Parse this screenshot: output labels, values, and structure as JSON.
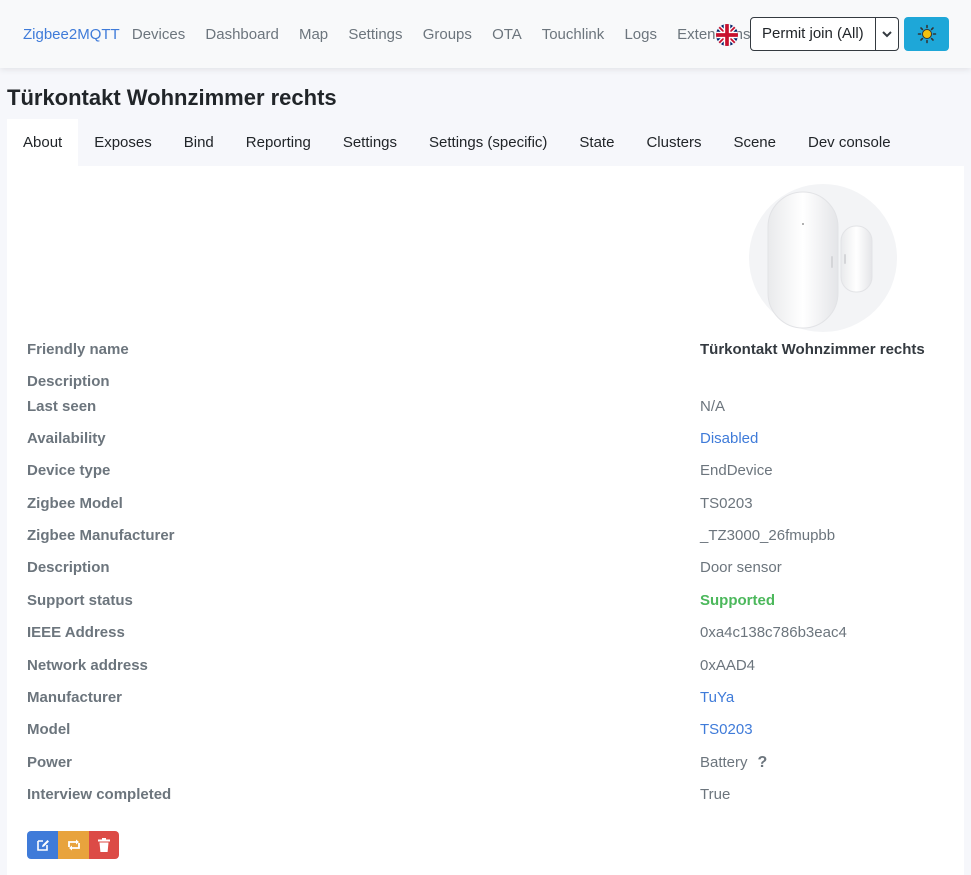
{
  "navbar": {
    "brand": "Zigbee2MQTT",
    "links": [
      "Devices",
      "Dashboard",
      "Map",
      "Settings",
      "Groups",
      "OTA",
      "Touchlink",
      "Logs",
      "Extensions"
    ],
    "language_icon": "uk-flag-icon",
    "permit_join_label": "Permit join (All)",
    "theme_icon": "sun-icon"
  },
  "page": {
    "title": "Türkontakt Wohnzimmer rechts"
  },
  "tabs": [
    "About",
    "Exposes",
    "Bind",
    "Reporting",
    "Settings",
    "Settings (specific)",
    "State",
    "Clusters",
    "Scene",
    "Dev console"
  ],
  "device": {
    "rows": [
      {
        "label": "Friendly name",
        "value": "Türkontakt Wohnzimmer rechts"
      },
      {
        "label": "Description",
        "value": ""
      },
      {
        "label": "Last seen",
        "value": "N/A"
      },
      {
        "label": "Availability",
        "value": "Disabled"
      },
      {
        "label": "Device type",
        "value": "EndDevice"
      },
      {
        "label": "Zigbee Model",
        "value": "TS0203"
      },
      {
        "label": "Zigbee Manufacturer",
        "value": "_TZ3000_26fmupbb"
      },
      {
        "label": "Description",
        "value": "Door sensor"
      },
      {
        "label": "Support status",
        "value": "Supported"
      },
      {
        "label": "IEEE Address",
        "value": "0xa4c138c786b3eac4"
      },
      {
        "label": "Network address",
        "value": "0xAAD4"
      },
      {
        "label": "Manufacturer",
        "value": "TuYa"
      },
      {
        "label": "Model",
        "value": "TS0203"
      },
      {
        "label": "Power",
        "value": "Battery"
      },
      {
        "label": "Interview completed",
        "value": "True"
      }
    ],
    "power_help": "?"
  },
  "actions": {
    "icons": [
      "edit-icon",
      "reconfigure-icon",
      "trash-icon"
    ]
  },
  "colors": {
    "link": "#3f7bd9",
    "success": "#4cb85c",
    "theme_button": "#1ea7d8",
    "edit": "#3f7bd9",
    "reconfigure": "#e8a33d",
    "remove": "#dc4b46"
  }
}
